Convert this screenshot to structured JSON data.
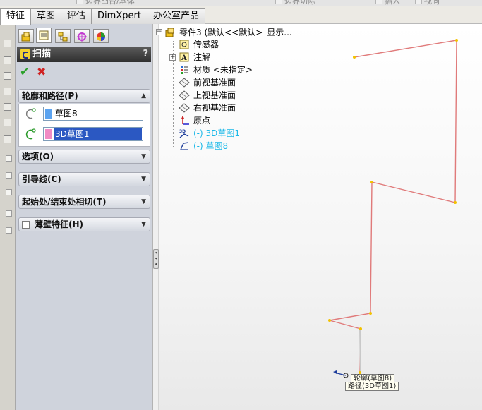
{
  "topbar": {
    "ghost_items": [
      "边界凸台/基体",
      "边界切除",
      "插入",
      "视向"
    ],
    "tabs": [
      {
        "label": "特征",
        "active": true
      },
      {
        "label": "草图",
        "active": false
      },
      {
        "label": "评估",
        "active": false
      },
      {
        "label": "DimXpert",
        "active": false
      },
      {
        "label": "办公室产品",
        "active": false
      }
    ]
  },
  "property_manager": {
    "title": "扫描",
    "help": "?",
    "ok_icon": "check-icon",
    "cancel_icon": "x-icon",
    "groups": {
      "profile_path": {
        "label": "轮廓和路径(P)",
        "expanded": true,
        "profile": {
          "value": "草图8",
          "color": "#5ba3f0"
        },
        "path": {
          "value": "3D草图1",
          "color": "#f08ac4",
          "selected": true
        }
      },
      "options": {
        "label": "选项(O)"
      },
      "guide_curves": {
        "label": "引导线(C)"
      },
      "start_end_tangency": {
        "label": "起始处/结束处相切(T)"
      },
      "thin_feature": {
        "label": "薄壁特征(H)",
        "checked": false
      }
    }
  },
  "feature_tree": {
    "root": "零件3 (默认<<默认>_显示...",
    "items": [
      {
        "label": "传感器",
        "icon": "sensor-icon"
      },
      {
        "label": "注解",
        "icon": "annotation-icon",
        "expandable": true
      },
      {
        "label": "材质 <未指定>",
        "icon": "material-icon"
      },
      {
        "label": "前视基准面",
        "icon": "plane-icon"
      },
      {
        "label": "上视基准面",
        "icon": "plane-icon"
      },
      {
        "label": "右视基准面",
        "icon": "plane-icon"
      },
      {
        "label": "原点",
        "icon": "origin-icon"
      },
      {
        "label": "(-) 3D草图1",
        "icon": "3d-sketch-icon",
        "highlight": true
      },
      {
        "label": "(-) 草图8",
        "icon": "sketch-icon",
        "highlight": true
      }
    ]
  },
  "viewport": {
    "callouts": {
      "profile": "轮廓(草图8)",
      "path": "路径(3D草图1)"
    },
    "path_color": "#e07a7a",
    "vertex_color": "#f2c200"
  }
}
